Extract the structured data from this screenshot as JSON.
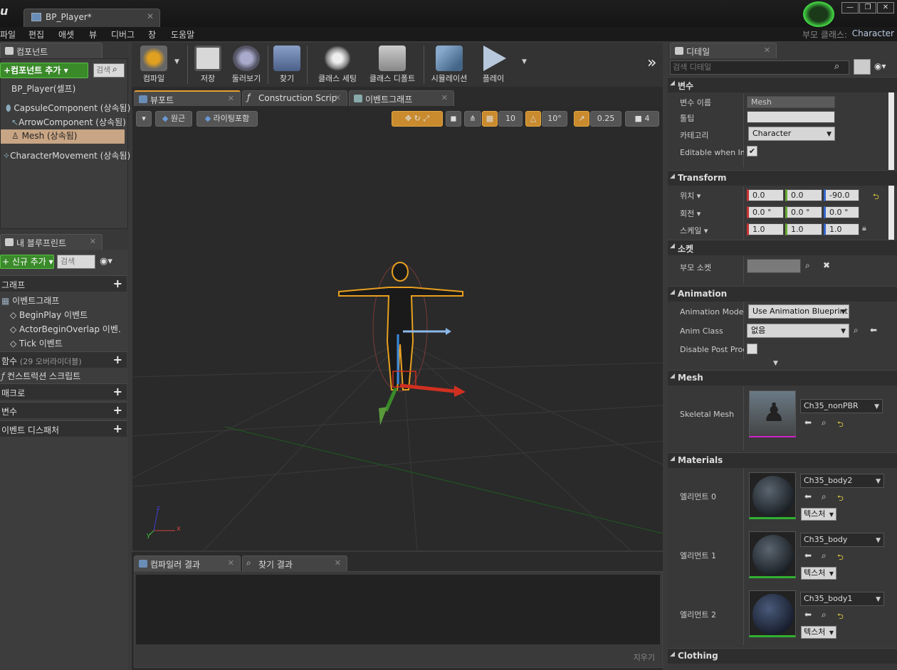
{
  "window": {
    "tab_title": "BP_Player*",
    "tab_close": "✕",
    "btn_minimize": "—",
    "btn_maximize": "❐",
    "btn_close": "✕",
    "parent_class_label": "부모 클래스:",
    "parent_class_value": "Character"
  },
  "menu": [
    "파일",
    "편집",
    "애셋",
    "뷰",
    "디버그",
    "창",
    "도움말"
  ],
  "components_panel": {
    "tab": "컴포넌트",
    "add_button": "+컴포넌트 추가 ▾",
    "search_placeholder": "검색",
    "root": "BP_Player(셀프)",
    "items": [
      "CapsuleComponent (상속됨)",
      "ArrowComponent (상속됨)",
      "Mesh (상속됨)",
      "CharacterMovement (상속됨)"
    ]
  },
  "blueprint_panel": {
    "tab": "내 블루프린트",
    "add_button": "+ 신규 추가 ▾",
    "search_placeholder": "검색",
    "graph_section": "그래프",
    "event_graph": "이벤트그래프",
    "events": [
      "BeginPlay 이벤트",
      "ActorBeginOverlap 이벤.",
      "Tick 이벤트"
    ],
    "functions_section": "함수",
    "functions_override": "(29 오버라이더블)",
    "construction_script": "컨스트럭션 스크립트",
    "macros_section": "매크로",
    "variables_section": "변수",
    "dispatchers_section": "이벤트 디스패처",
    "plus": "+"
  },
  "toolbar": {
    "items": [
      "컴파일",
      "저장",
      "둘러보기",
      "찾기",
      "클래스 세팅",
      "클래스 디폴트",
      "시뮬레이션",
      "플레이"
    ],
    "more": "»"
  },
  "editor_tabs": [
    "뷰포트",
    "Construction Scrip",
    "이벤트그래프"
  ],
  "viewport": {
    "perspective_btn": "원근",
    "lighting_btn": "라이팅포함",
    "grid_snap": "10",
    "rot_snap": "10°",
    "scale_snap": "0.25",
    "camera_speed": "4",
    "axis_x": "x",
    "axis_y": "y",
    "axis_z": "z"
  },
  "bottom_tabs": [
    "컴파일러 결과",
    "찾기 결과"
  ],
  "clear_button": "지우기",
  "details": {
    "tab": "디테일",
    "search_placeholder": "검색 디테일",
    "variable_section": "변수",
    "var_name_label": "변수 이름",
    "var_name_value": "Mesh",
    "tooltip_label": "툴팁",
    "tooltip_value": "",
    "category_label": "카테고리",
    "category_value": "Character",
    "editable_label": "Editable when Inhe",
    "transform_section": "Transform",
    "location_label": "위치 ▾",
    "location": [
      "0.0",
      "0.0",
      "-90.0"
    ],
    "rotation_label": "회전 ▾",
    "rotation": [
      "0.0 °",
      "0.0 °",
      "0.0 °"
    ],
    "scale_label": "스케일 ▾",
    "scale": [
      "1.0",
      "1.0",
      "1.0"
    ],
    "sockets_section": "소켓",
    "parent_socket_label": "부모 소켓",
    "animation_section": "Animation",
    "anim_mode_label": "Animation Mode",
    "anim_mode_value": "Use Animation Blueprint",
    "anim_class_label": "Anim Class",
    "anim_class_value": "없음",
    "disable_post_label": "Disable Post Proc",
    "mesh_section": "Mesh",
    "skeletal_mesh_label": "Skeletal Mesh",
    "skeletal_mesh_value": "Ch35_nonPBR",
    "materials_section": "Materials",
    "materials": [
      {
        "label": "엘리먼트 0",
        "value": "Ch35_body2"
      },
      {
        "label": "엘리먼트 1",
        "value": "Ch35_body"
      },
      {
        "label": "엘리먼트 2",
        "value": "Ch35_body1"
      }
    ],
    "texture_btn": "텍스처",
    "clothing_section": "Clothing"
  },
  "colors": {
    "accent_green": "#3a8a2a",
    "selection": "#c8a584",
    "snap_orange": "#c98b2e"
  }
}
